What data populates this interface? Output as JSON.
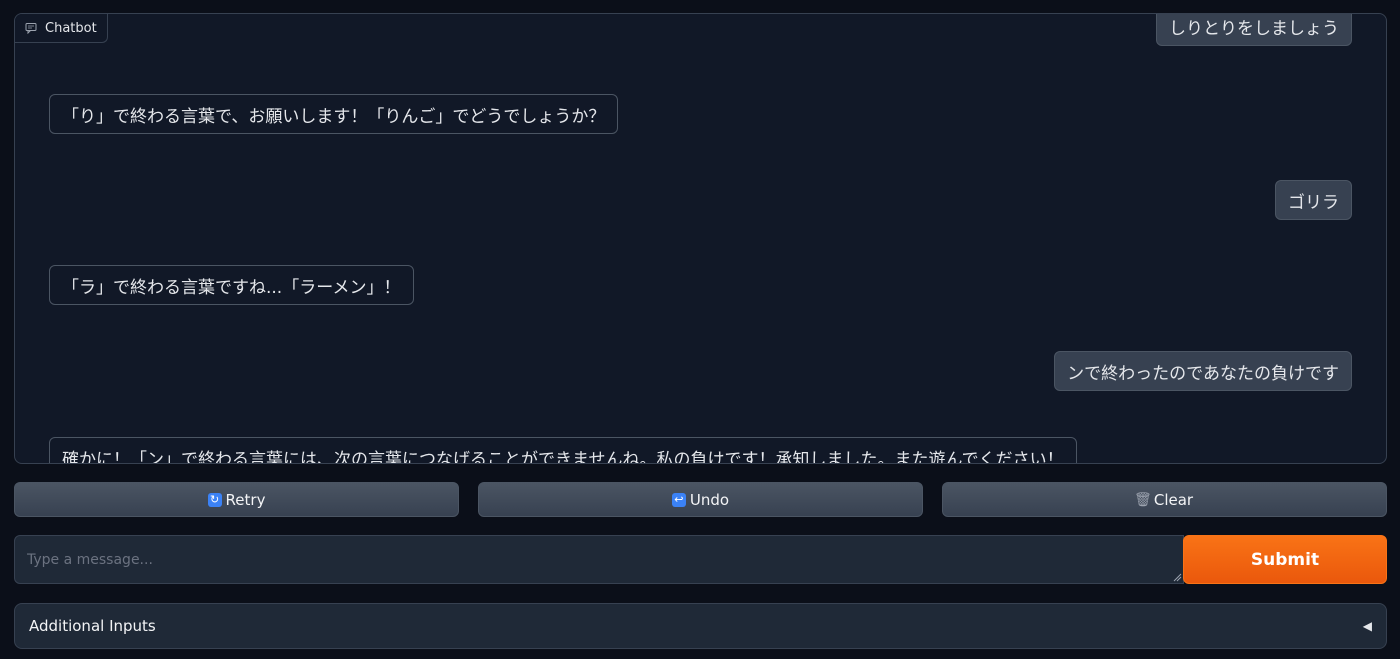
{
  "chatbot": {
    "label": "Chatbot",
    "messages": [
      {
        "role": "user",
        "text": "しりとりをしましょう"
      },
      {
        "role": "bot",
        "text": "「り」で終わる言葉で、お願いします！「りんご」でどうでしょうか？"
      },
      {
        "role": "user",
        "text": "ゴリラ"
      },
      {
        "role": "bot",
        "text": "「ラ」で終わる言葉ですね...「ラーメン」！"
      },
      {
        "role": "user",
        "text": "ンで終わったのであなたの負けです"
      },
      {
        "role": "bot",
        "text": "確かに！「ン」で終わる言葉には、次の言葉につなげることができませんね。私の負けです！承知しました。また遊んでください！"
      }
    ]
  },
  "buttons": {
    "retry": {
      "icon": "retry-icon",
      "label": "Retry"
    },
    "undo": {
      "icon": "undo-icon",
      "label": "Undo"
    },
    "clear": {
      "icon": "trash-icon",
      "label": "Clear"
    }
  },
  "input": {
    "placeholder": "Type a message...",
    "value": ""
  },
  "submit": {
    "label": "Submit"
  },
  "accordion": {
    "label": "Additional Inputs",
    "icon": "caret-left-icon"
  },
  "colors": {
    "background": "#0b0f19",
    "panel": "#111827",
    "user_bubble": "#374151",
    "accent": "#f97316"
  }
}
